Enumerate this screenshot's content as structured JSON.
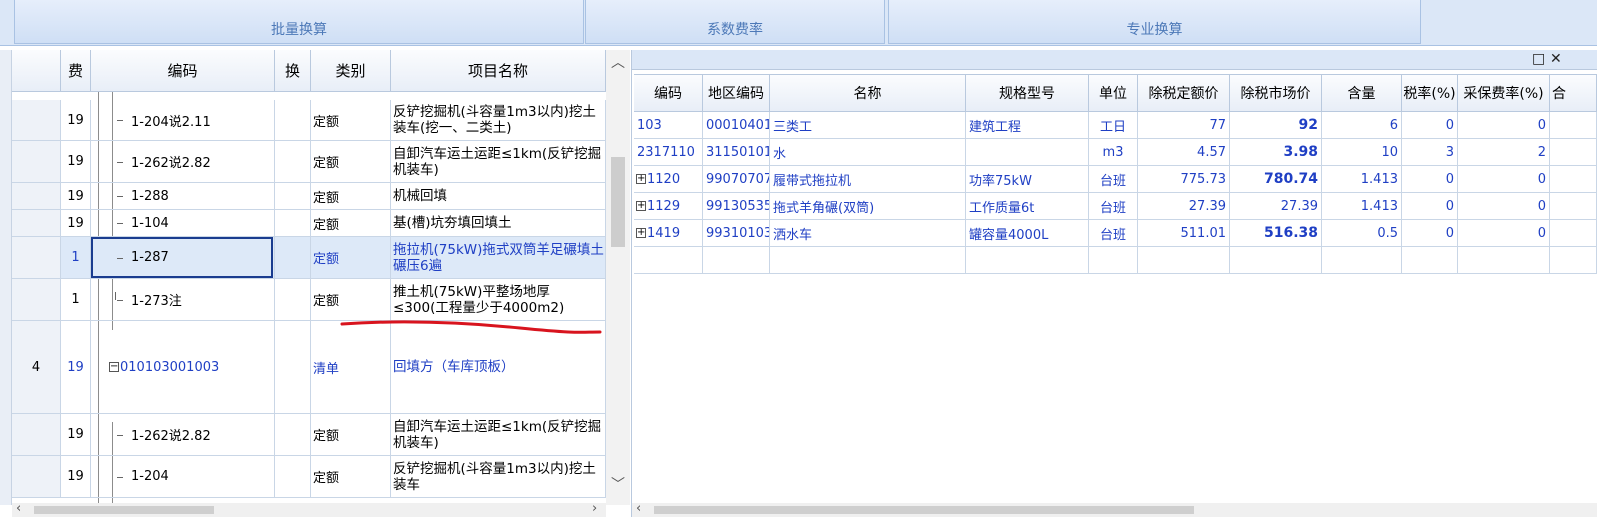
{
  "toolbar": {
    "groups": [
      {
        "label": "批量换算"
      },
      {
        "label": "系数费率"
      },
      {
        "label": "专业换算"
      }
    ]
  },
  "left_table": {
    "headers": {
      "fee": "费",
      "code": "编码",
      "swap": "换",
      "type": "类别",
      "name": "项目名称"
    },
    "rows": [
      {
        "no": "",
        "fee": "19",
        "code": "1-204说2.11",
        "type": "定额",
        "name": "反铲挖掘机(斗容量1m3以内)挖土装车(挖一、二类土)"
      },
      {
        "no": "",
        "fee": "19",
        "code": "1-262说2.82",
        "type": "定额",
        "name": "自卸汽车运土运距≤1km(反铲挖掘机装车)"
      },
      {
        "no": "",
        "fee": "19",
        "code": "1-288",
        "type": "定额",
        "name": "机械回填"
      },
      {
        "no": "",
        "fee": "19",
        "code": "1-104",
        "type": "定额",
        "name": "基(槽)坑夯填回填土"
      },
      {
        "no": "",
        "fee": "1",
        "code": "1-287",
        "type": "定额",
        "name": "拖拉机(75kW)拖式双筒羊足碾填土碾压6遍"
      },
      {
        "no": "",
        "fee": "1",
        "code": "1-273注",
        "type": "定额",
        "name": "推土机(75kW)平整场地厚≤300(工程量少于4000m2)"
      },
      {
        "no": "4",
        "fee": "19",
        "code": "010103001003",
        "type": "清单",
        "name": "回填方（车库顶板）"
      },
      {
        "no": "",
        "fee": "19",
        "code": "1-262说2.82",
        "type": "定额",
        "name": "自卸汽车运土运距≤1km(反铲挖掘机装车)"
      },
      {
        "no": "",
        "fee": "19",
        "code": "1-204",
        "type": "定额",
        "name": "反铲挖掘机(斗容量1m3以内)挖土装车"
      }
    ]
  },
  "right_table": {
    "headers": {
      "code": "编码",
      "region_code": "地区编码",
      "name": "名称",
      "spec": "规格型号",
      "unit": "单位",
      "quota_price": "除税定额价",
      "market_price": "除税市场价",
      "qty": "含量",
      "tax": "税率(%)",
      "purchase": "采保费率(%)",
      "extra": "合"
    },
    "rows": [
      {
        "code": "103",
        "region_code": "00010401",
        "name": "三类工",
        "spec": "建筑工程",
        "unit": "工日",
        "quota_price": "77",
        "market_price": "92",
        "qty": "6",
        "tax": "0",
        "purchase": "0"
      },
      {
        "code": "2317110",
        "region_code": "31150101",
        "name": "水",
        "spec": "",
        "unit": "m3",
        "quota_price": "4.57",
        "market_price": "3.98",
        "qty": "10",
        "tax": "3",
        "purchase": "2"
      },
      {
        "code": "1120",
        "region_code": "99070707",
        "name": "履带式拖拉机",
        "spec": "功率75kW",
        "unit": "台班",
        "quota_price": "775.73",
        "market_price": "780.74",
        "qty": "1.413",
        "tax": "0",
        "purchase": "0"
      },
      {
        "code": "1129",
        "region_code": "99130535",
        "name": "拖式羊角碾(双筒)",
        "spec": "工作质量6t",
        "unit": "台班",
        "quota_price": "27.39",
        "market_price": "27.39",
        "qty": "1.413",
        "tax": "0",
        "purchase": "0"
      },
      {
        "code": "1419",
        "region_code": "99310103",
        "name": "洒水车",
        "spec": "罐容量4000L",
        "unit": "台班",
        "quota_price": "511.01",
        "market_price": "516.38",
        "qty": "0.5",
        "tax": "0",
        "purchase": "0"
      }
    ]
  },
  "icons": [
    "restore-icon",
    "close-icon",
    "scroll-up-icon",
    "scroll-down-icon",
    "scroll-left-icon",
    "scroll-right-icon",
    "expand-icon",
    "collapse-icon"
  ],
  "colors": {
    "link_blue": "#1f3fc4",
    "selection": "#dde9f8",
    "annotation_red": "#d8141e"
  }
}
